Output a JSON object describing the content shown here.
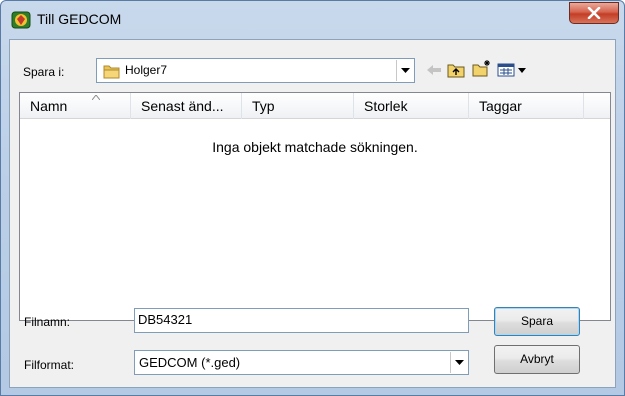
{
  "window": {
    "title": "Till GEDCOM",
    "close_symbol": "X",
    "colors": {
      "close": "#c33d25",
      "frame": "#bcd0e8"
    }
  },
  "save_in": {
    "label": "Spara i:",
    "value": "Holger7",
    "folder_icon": "folder-icon"
  },
  "toolbar": {
    "back_icon": "back-arrow-icon",
    "up_icon": "up-folder-icon",
    "new_folder_icon": "new-folder-icon",
    "view_icon": "view-menu-icon"
  },
  "list": {
    "columns": [
      "Namn",
      "Senast änd...",
      "Typ",
      "Storlek",
      "Taggar"
    ],
    "empty_message": "Inga objekt matchade sökningen."
  },
  "filename": {
    "label": "Filnamn:",
    "value": "DB54321"
  },
  "fileformat": {
    "label": "Filformat:",
    "value": "GEDCOM (*.ged)"
  },
  "buttons": {
    "save": "Spara",
    "cancel": "Avbryt"
  }
}
